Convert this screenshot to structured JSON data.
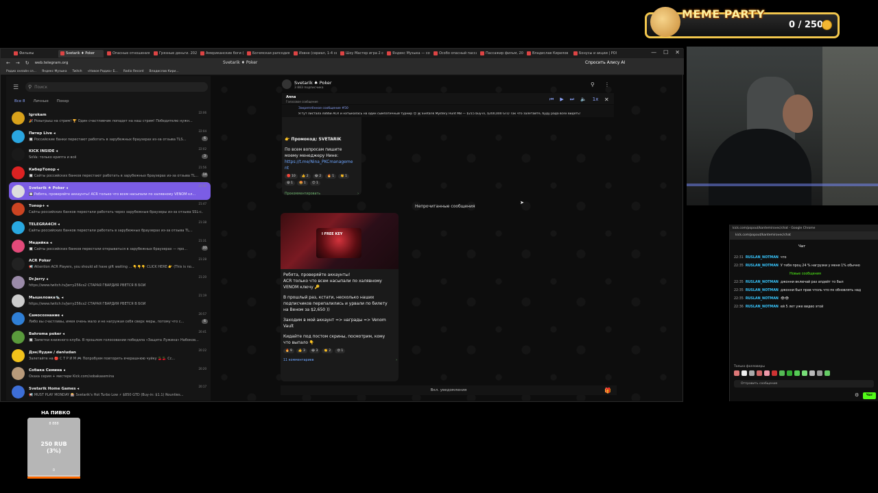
{
  "overlay": {
    "meme_title": "MEME PARTY",
    "meme_score": "0 / 250"
  },
  "browser": {
    "tabs": [
      "Фильмы",
      "Svetarik ♦ Poker",
      "Опасные отношения (",
      "Грязные деньги. 202",
      "Американские боги (",
      "Богемская рапсодия (",
      "Извне (сериал, 1-4 се",
      "Шоу Мастер игра 2 се",
      "Яндекс Музыка — соб",
      "Особо опасный пасса",
      "Пассажир фильм, 202",
      "Владислав Кирилов",
      "Бонусы и акции | РОЯ"
    ],
    "active_tab": 1,
    "url": "web.telegram.org",
    "center_title": "Svetarik ♦ Poker",
    "ask_alice": "Спросить Алису AI",
    "bookmarks": [
      "Радио онлайн сл...",
      "Яндекс Музыка",
      "Twitch",
      "«Новое Радио» Б...",
      "Radio Record",
      "Владислав Кири..."
    ]
  },
  "sidebar": {
    "search_placeholder": "Поиск",
    "folders": [
      "Все",
      "Личные",
      "Покер"
    ],
    "all_count": "8",
    "chats": [
      {
        "name": "Igrokam",
        "preview": "🎉 Розыгрыш на стрим! 🏆 Один счастливчик попадет на наш стрим! Победителю нужн...",
        "time": "22:06",
        "badge": "",
        "color": "#d9a21b"
      },
      {
        "name": "Питер Live ◂",
        "preview": "🔲 Российские банки перестают работать в зарубежных браузерах из-за отзыва TLS...",
        "time": "22:04",
        "badge": "6",
        "color": "#2aa6e0"
      },
      {
        "name": "KICK INSIDE ◂",
        "preview": "SoVa: только крипта и всё",
        "time": "22:02",
        "badge": "3",
        "color": "#1a1a1a"
      },
      {
        "name": "КиберТопор ◂",
        "preview": "🔲 Сайты российских банков перестают работать в зарубежных браузерах из-за отзыва TL...",
        "time": "21:56",
        "badge": "14",
        "color": "#d22"
      },
      {
        "name": "Svetarik ♠ Poker ◂",
        "preview": "🔲 Ребята, проверяйте аккаунты! ACR только что всем насыпали по халявному VENOM кл...",
        "time": "21:50",
        "badge": "",
        "color": "#ddd"
      },
      {
        "name": "Топор+ ◂",
        "preview": "Сайты российских банков перестали работать через зарубежные браузеры из-за отзыва SSL-с...",
        "time": "21:47",
        "badge": "",
        "color": "#c42"
      },
      {
        "name": "TELEGRA4CH ◂",
        "preview": "Сайты российских банков перестали работать в зарубежных браузерах из-за отзыва TL...",
        "time": "21:38",
        "badge": "",
        "color": "#29a8e0"
      },
      {
        "name": "Медийка ◂",
        "preview": "🔲 Сайты российских банков перестали открываться в зарубежных браузерах — про...",
        "time": "21:31",
        "badge": "33",
        "color": "#e34a7a"
      },
      {
        "name": "ACR Poker",
        "preview": "📢 Attention ACR Players, you should all have gift waiting ... 👇👇👇 CLICK HERE 👉 (This is no...",
        "time": "21:28",
        "badge": "",
        "color": "#222"
      },
      {
        "name": "Dr.Jerry ◂",
        "preview": "https://www.twitch.tv/jerry256cs2 СТАРАЯ ГВАРДИЯ РВЕТСЯ В БОЙ",
        "time": "21:20",
        "badge": "",
        "color": "#9a8aa8"
      },
      {
        "name": "Мышеловка🐀 ◂",
        "preview": "https://www.twitch.tv/jerry256cs2 СТАРАЯ ГВАРДИЯ РВЕТСЯ В БОЙ",
        "time": "21:19",
        "badge": "",
        "color": "#ccc"
      },
      {
        "name": "Самосознание ◂",
        "preview": "Либо вы счастливы, имея очень мало и не нагружая себя сверх меры, потому что с...",
        "time": "20:57",
        "badge": "6",
        "color": "#2f7fd6"
      },
      {
        "name": "Bahroma poker ◂",
        "preview": "🔲 Заметки книжного клуба. В прошлом голосовании победила «Защита Лужина» Набоков...",
        "time": "20:41",
        "badge": "",
        "color": "#5a9a3c"
      },
      {
        "name": "Дэн/Лудан / danludan",
        "preview": "Залетайте на 🔴 С Т Р И М 🎮 Попробуем повторить вчерашнюю чуйку 🍒🍒 Сс...",
        "time": "20:22",
        "badge": "",
        "color": "#f2c21b"
      },
      {
        "name": "Собака Семина ◂",
        "preview": "Охаха серия + мистери Kick.com/sobakasemina",
        "time": "20:20",
        "badge": "",
        "color": "#b89a7a"
      },
      {
        "name": "Svetarik Home Games ◂",
        "preview": "📢 MUST PLAY MONDAY 🎰 Svetarik's Hot Turbo Low ⚡ $850 GTD (Buy-in: $1.1) Rounties...",
        "time": "20:17",
        "badge": "",
        "color": "#3d6ed6"
      }
    ]
  },
  "main": {
    "channel_name": "Svetarik ♠ Poker",
    "channel_subs": "3 883 подписчика",
    "voice_author": "Anna",
    "voice_kind": "Голосовое сообщение",
    "pinned_label": "Закреплённое сообщение #50",
    "pinned_text": "Я тут листала лобби ACR и натыкалась на один сымпатичный турнир 😊 🃏 Svetarik Mystery Hunt M8 — $215 buy-in, $200,000 GTD Так что залетайте, буду рада всех видеть!",
    "msg1": {
      "promo": "👉 Промокод: SVETARIK",
      "line1": "По всем вопросам пишите",
      "line2": "моему менеджеру Нине:",
      "link1": "https://t.me/Nina_PKCmanageme",
      "link2": "nt",
      "reactions": [
        "🔴 10",
        "👍 2",
        "😂 2",
        "🔥 1",
        "👏 1",
        "😁 1",
        "🤩 1",
        "😊 1"
      ],
      "comment_label": "Прокомментировать",
      "time": "1 ⊙ 19:27"
    },
    "unread_label": "Непрочитанные сообщения",
    "msg2": {
      "preview_label": "I FREE KEY",
      "lines": [
        "Ребята, проверяйте аккаунты!",
        "ACR только что всем насыпали по халявному",
        "VENOM ключу 🔑",
        "",
        "В прошлый раз, кстати, несколько наших",
        "подписчиков перепалились и урвали по билету",
        "на Веном за $2,650 ))",
        "",
        "Заходим в мой аккаунт => награды => Venom",
        "Vault",
        "",
        "Кидайте под постом скрины, посмотрим, кому",
        "что выпало 👇"
      ],
      "reactions": [
        "🔥 9",
        "👍 3",
        "😂 3",
        "👏 2",
        "😡 1"
      ],
      "comments": "11 комментариев"
    },
    "composer_label": "Вкл. уведомления"
  },
  "kick": {
    "titlebar": "kick.com/popout/kantemirovec/chat - Google Chrome",
    "url": "kick.com/popout/kantemirovec/chat",
    "chat_title": "Чат",
    "messages": [
      {
        "time": "22:31",
        "user": "RUSLAN_NOTMAN",
        "text": "что",
        "sys": false
      },
      {
        "time": "22:35",
        "user": "RUSLAN_NOTMAN",
        "text": "У тебя проц 24 % нагрузки у меня 1% обычно",
        "sys": false
      },
      {
        "time": "",
        "user": "",
        "text": "Новые сообщения",
        "sys": true
      },
      {
        "time": "22:35",
        "user": "RUSLAN_NOTMAN",
        "text": "джонни включай раз апдейт то был",
        "sys": false
      },
      {
        "time": "22:35",
        "user": "RUSLAN_NOTMAN",
        "text": "джонни был прав чтоль что пк обновлять над",
        "sys": false
      },
      {
        "time": "22:35",
        "user": "RUSLAN_NOTMAN",
        "text": "👁👁",
        "sys": false
      },
      {
        "time": "22:36",
        "user": "RUSLAN_NOTMAN",
        "text": "ей 5 лет уже видео этой",
        "sys": false
      }
    ],
    "bottom_label": "Только фолловеры",
    "input_placeholder": "Отправить сообщение",
    "send_label": "Чат"
  },
  "donation": {
    "title": "НА ПИВКО",
    "goal": "8 888",
    "amount": "250 RUB",
    "percent": "(3%)",
    "start": "0"
  }
}
